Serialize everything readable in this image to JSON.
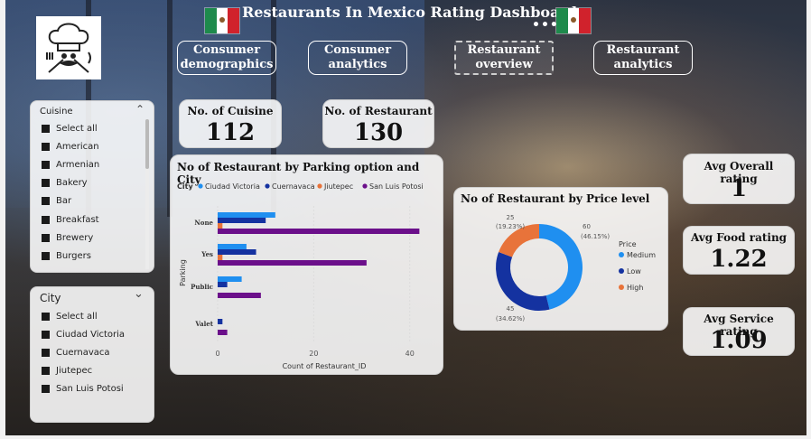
{
  "dashboard": {
    "title": "Restaurants In Mexico Rating Dashboard",
    "more_icon": "•••",
    "colors": {
      "title": "#ffffff",
      "flag_green": "#1e8a4c",
      "flag_red": "#d0222c"
    }
  },
  "nav": [
    {
      "label": "Consumer demographics"
    },
    {
      "label": "Consumer analytics"
    },
    {
      "label": "Restaurant overview"
    },
    {
      "label": "Restaurant analytics"
    }
  ],
  "kpis": {
    "cuisine": {
      "label": "No. of Cuisine",
      "value": "112"
    },
    "restaurant": {
      "label": "No. of Restaurant",
      "value": "130"
    },
    "overall": {
      "label": "Avg Overall rating",
      "value": "1"
    },
    "food": {
      "label": "Avg Food rating",
      "value": "1.22"
    },
    "service": {
      "label": "Avg Service rating",
      "value": "1.09"
    }
  },
  "slicers": {
    "cuisine": {
      "title": "Cuisine",
      "items": [
        "Select all",
        "American",
        "Armenian",
        "Bakery",
        "Bar",
        "Breakfast",
        "Brewery",
        "Burgers"
      ]
    },
    "city": {
      "title": "City",
      "items": [
        "Select all",
        "Ciudad Victoria",
        "Cuernavaca",
        "Jiutepec",
        "San Luis Potosi"
      ]
    }
  },
  "chart_data": [
    {
      "type": "bar",
      "orientation": "horizontal",
      "title": "No of Restaurant by Parking option and City",
      "legend_title": "City",
      "legend_position": "top",
      "categories": [
        "None",
        "Yes",
        "Public",
        "Valet"
      ],
      "series": [
        {
          "name": "Ciudad Victoria",
          "color": "#1f8ff0",
          "values": [
            12,
            6,
            5,
            0
          ]
        },
        {
          "name": "Cuernavaca",
          "color": "#1432a0",
          "values": [
            10,
            8,
            2,
            1
          ]
        },
        {
          "name": "Jiutepec",
          "color": "#e8733a",
          "values": [
            1,
            1,
            0,
            0
          ]
        },
        {
          "name": "San Luis Potosi",
          "color": "#6b0f8a",
          "values": [
            42,
            31,
            9,
            2
          ]
        }
      ],
      "xlabel": "Count of Restaurant_ID",
      "ylabel": "Parking",
      "xticks": [
        0,
        20,
        40
      ],
      "xlim": [
        0,
        44
      ],
      "grid": true
    },
    {
      "type": "pie",
      "donut": true,
      "title": "No of Restaurant by Price level",
      "legend_title": "Price",
      "legend_position": "right",
      "slices": [
        {
          "name": "Medium",
          "value": 60,
          "pct": "(46.15%)",
          "color": "#1f8ff0"
        },
        {
          "name": "Low",
          "value": 45,
          "pct": "(34.62%)",
          "color": "#1432a0"
        },
        {
          "name": "High",
          "value": 25,
          "pct": "(19.23%)",
          "color": "#e8733a"
        }
      ]
    }
  ]
}
